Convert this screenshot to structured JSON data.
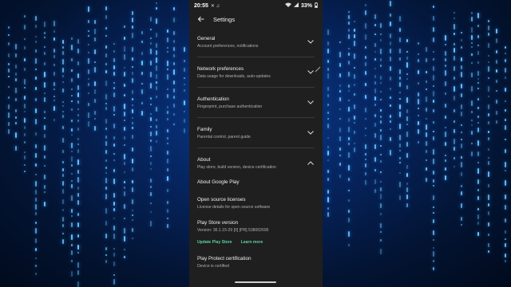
{
  "status_bar": {
    "time": "20:55",
    "battery": "33%"
  },
  "app_bar": {
    "title": "Settings"
  },
  "sections": [
    {
      "title": "General",
      "subtitle": "Account preferences, notifications",
      "expanded": false
    },
    {
      "title": "Network preferences",
      "subtitle": "Data usage for downloads, auto-updates",
      "expanded": false
    },
    {
      "title": "Authentication",
      "subtitle": "Fingerprint, purchase authentication",
      "expanded": false
    },
    {
      "title": "Family",
      "subtitle": "Parental control, parent guide",
      "expanded": false
    },
    {
      "title": "About",
      "subtitle": "Play store, build version, device certification",
      "expanded": true
    }
  ],
  "about": {
    "about_google_play": "About Google Play",
    "open_source": {
      "title": "Open source licenses",
      "subtitle": "License details for open source software"
    },
    "version": {
      "title": "Play Store version",
      "subtitle": "Version: 36.1.15-29 [0] [PR] 538002695"
    },
    "update_link": "Update Play Store",
    "learn_more_link": "Learn more",
    "protect": {
      "title": "Play Protect certification",
      "subtitle": "Device is certified"
    }
  },
  "colors": {
    "surface": "#1f1f1f",
    "link": "#5dcf9e",
    "background": "#06245e"
  },
  "icons": [
    "back-arrow-icon",
    "chevron-down-icon",
    "chevron-up-icon",
    "pencil-icon",
    "wifi-icon",
    "battery-icon"
  ]
}
